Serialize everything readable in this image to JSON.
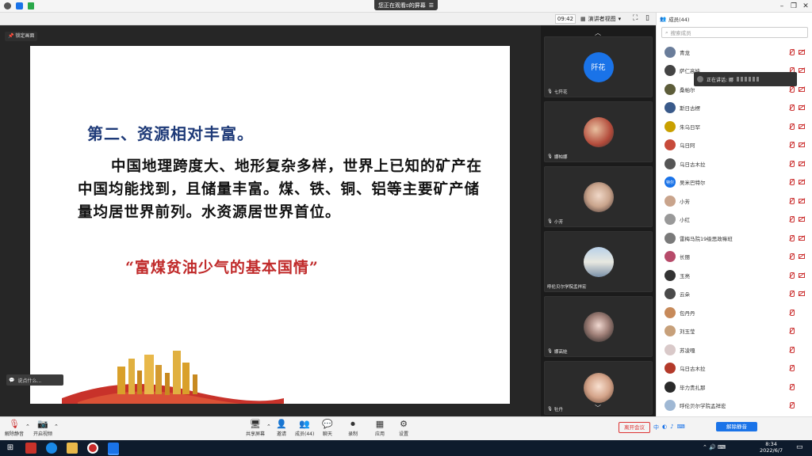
{
  "window": {
    "share_banner": "您正在观看ಠ的屏幕",
    "clock": "09:42",
    "view_label": "演讲者视图",
    "lock_label": "锁定画面"
  },
  "slide": {
    "heading": "第二、资源相对丰富。",
    "paragraph": "中国地理跨度大、地形复杂多样，世界上已知的矿产在中国均能找到，且储量丰富。煤、铁、铜、铝等主要矿产储量均居世界前列。水资源居世界首位。",
    "quote": "“富煤贫油少气的基本国情”"
  },
  "caption": {
    "label": "说点什么..."
  },
  "gallery": {
    "tiles": [
      {
        "name": "七阡花",
        "initials": "阡花",
        "color": "#1a73e8"
      },
      {
        "name": "娜帕娜",
        "color": "#b24a3a"
      },
      {
        "name": "小芳",
        "color": "#c9a48c"
      },
      {
        "name": "呼伦贝尔学院孟祥宏",
        "color": "#9fb8d4"
      },
      {
        "name": "娜高娃",
        "color": "#3a2a2a"
      },
      {
        "name": "牡丹",
        "color": "#d4a48a"
      }
    ]
  },
  "members": {
    "header": "成员(44)",
    "search_placeholder": "搜索成员",
    "speaking_prefix": "正在讲话: 娜",
    "list": [
      {
        "name": "青龙",
        "color": "#6a7d9a",
        "mic": true,
        "cam": true
      },
      {
        "name": "萨仁高娃",
        "color": "#444444",
        "mic": true,
        "cam": true
      },
      {
        "name": "桑帕尔",
        "color": "#5d5d3a",
        "mic": true,
        "cam": true
      },
      {
        "name": "斯日古楞",
        "color": "#3a5a8a",
        "mic": true,
        "cam": true
      },
      {
        "name": "朱乌日罕",
        "color": "#c9a000",
        "mic": true,
        "cam": true
      },
      {
        "name": "乌日阿",
        "color": "#c74a3a",
        "mic": true,
        "cam": true
      },
      {
        "name": "乌日古木拉",
        "color": "#555555",
        "mic": true,
        "cam": true
      },
      {
        "name": "吴米巴特尔",
        "initials": "特尔",
        "color": "#1a73e8",
        "mic": true,
        "cam": true
      },
      {
        "name": "小芳",
        "color": "#c9a48c",
        "mic": true,
        "cam": true
      },
      {
        "name": "小红",
        "color": "#999999",
        "mic": true,
        "cam": true
      },
      {
        "name": "雷梅马院19级思政嘛班",
        "color": "#7a7a7a",
        "mic": true,
        "cam": true
      },
      {
        "name": "长丽",
        "color": "#b74b6a",
        "mic": true,
        "cam": true
      },
      {
        "name": "玉亮",
        "color": "#333333",
        "mic": true,
        "cam": true
      },
      {
        "name": "云朵",
        "color": "#4a4a4a",
        "mic": true,
        "cam": true
      },
      {
        "name": "包丹丹",
        "color": "#c78a5a",
        "mic": true,
        "cam": false
      },
      {
        "name": "刘玉莹",
        "color": "#c7a07a",
        "mic": true,
        "cam": false
      },
      {
        "name": "苏凌嘎",
        "color": "#d9c9c9",
        "mic": true,
        "cam": false
      },
      {
        "name": "乌日古木拉",
        "color": "#b33a2a",
        "mic": true,
        "cam": false
      },
      {
        "name": "毕力贵扎那",
        "color": "#2a2a2a",
        "mic": true,
        "cam": false
      },
      {
        "name": "呼伦贝尔学院孟祥宏",
        "color": "#9fb8d4",
        "mic": true,
        "cam": false
      }
    ]
  },
  "controls": {
    "unmute": "解除静音",
    "start_video": "开启视频",
    "share_screen": "共享屏幕",
    "invite": "邀请",
    "members": "成员(44)",
    "chat": "聊天",
    "record": "录制",
    "apps": "应用",
    "settings": "设置",
    "leave": "离开会议",
    "unmute_all": "解除静音"
  },
  "taskbar": {
    "time": "8:34",
    "date": "2022/6/7",
    "ime": "中"
  }
}
